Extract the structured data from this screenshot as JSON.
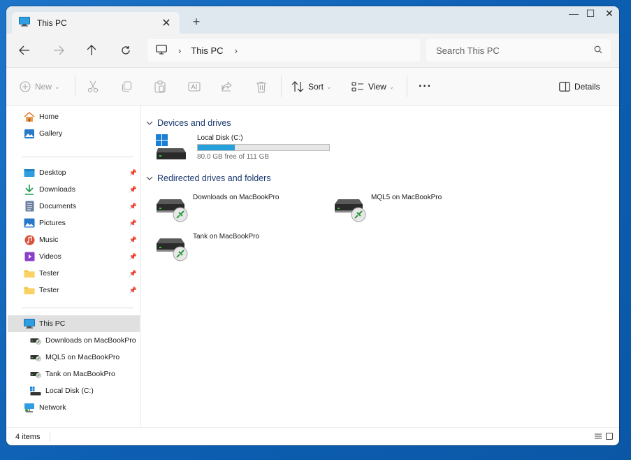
{
  "window": {
    "tab_title": "This PC",
    "controls": {
      "minimize": "—",
      "maximize": "☐",
      "close": "✕"
    }
  },
  "nav": {
    "breadcrumb": [
      "This PC"
    ],
    "search_placeholder": "Search This PC"
  },
  "commands": {
    "new_label": "New",
    "sort_label": "Sort",
    "view_label": "View",
    "more_label": "···",
    "details_label": "Details"
  },
  "sidebar": {
    "quick": [
      {
        "label": "Home",
        "icon": "home-icon"
      },
      {
        "label": "Gallery",
        "icon": "gallery-icon"
      }
    ],
    "pinned": [
      {
        "label": "Desktop",
        "icon": "desktop-folder-icon"
      },
      {
        "label": "Downloads",
        "icon": "downloads-icon"
      },
      {
        "label": "Documents",
        "icon": "documents-icon"
      },
      {
        "label": "Pictures",
        "icon": "pictures-icon"
      },
      {
        "label": "Music",
        "icon": "music-icon"
      },
      {
        "label": "Videos",
        "icon": "videos-icon"
      },
      {
        "label": "Tester",
        "icon": "folder-icon"
      },
      {
        "label": "Tester",
        "icon": "folder-icon"
      }
    ],
    "this_pc": {
      "label": "This PC",
      "icon": "this-pc-icon"
    },
    "this_pc_children": [
      {
        "label": "Downloads on MacBookPro",
        "icon": "network-drive-icon"
      },
      {
        "label": "MQL5 on MacBookPro",
        "icon": "network-drive-icon"
      },
      {
        "label": "Tank on MacBookPro",
        "icon": "network-drive-icon"
      },
      {
        "label": "Local Disk (C:)",
        "icon": "windows-drive-icon"
      }
    ],
    "network": {
      "label": "Network",
      "icon": "network-icon"
    }
  },
  "main": {
    "groups": [
      {
        "title": "Devices and drives",
        "items": [
          {
            "name": "Local Disk (C:)",
            "free_text": "80.0 GB free of 111 GB",
            "used_fraction": 0.28
          }
        ]
      },
      {
        "title": "Redirected drives and folders",
        "items": [
          {
            "name": "Downloads on MacBookPro"
          },
          {
            "name": "MQL5 on MacBookPro"
          },
          {
            "name": "Tank on MacBookPro"
          }
        ]
      }
    ]
  },
  "status": {
    "item_count": "4 items"
  },
  "colors": {
    "accent": "#26a0da",
    "selection": "#e0e0e0",
    "header_text": "#1b3a70"
  }
}
